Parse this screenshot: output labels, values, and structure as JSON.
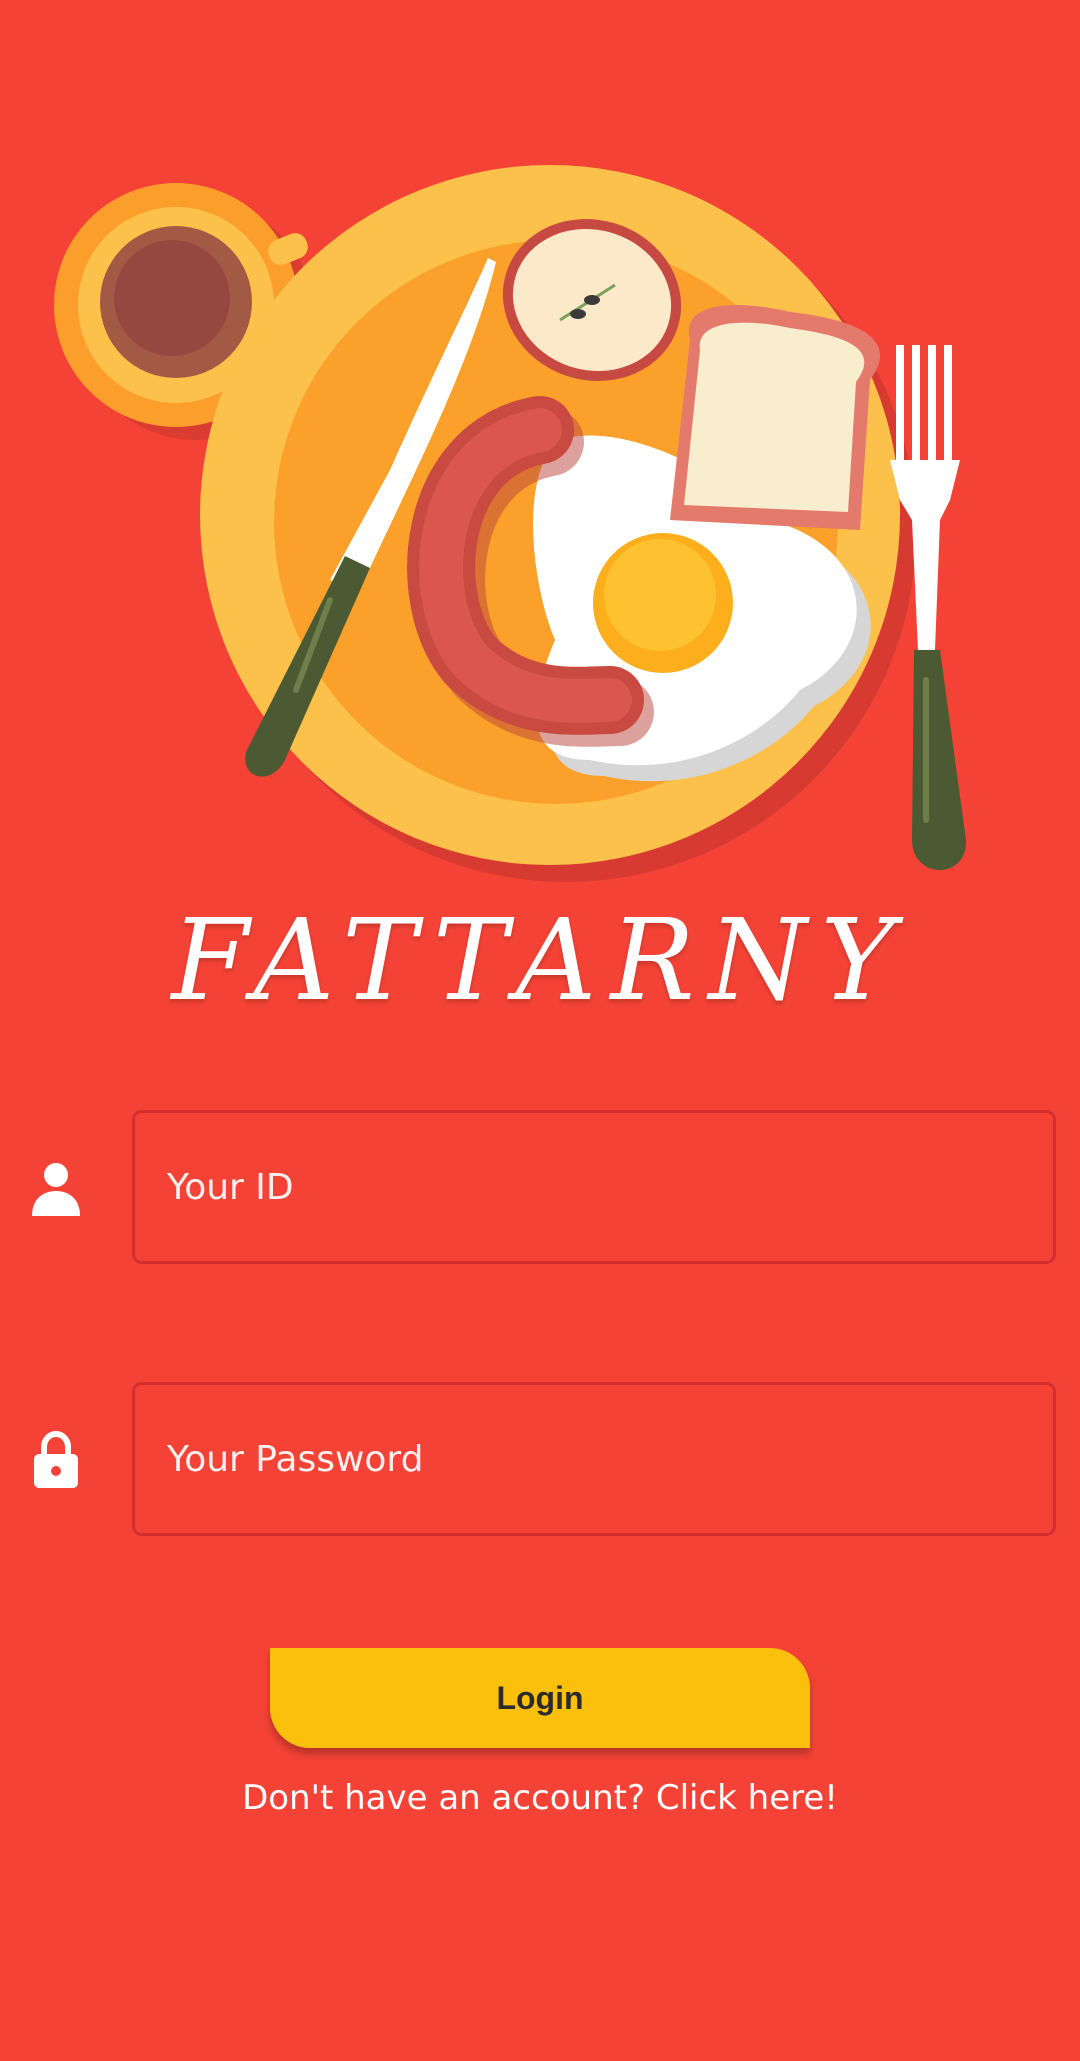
{
  "app": {
    "name": "FATTARNY"
  },
  "colors": {
    "background": "#f44336",
    "plate": "#fcc14a",
    "button": "#fbc00b",
    "field_border": "#d32f2f",
    "text": "#ffffff"
  },
  "hero": {
    "icon": "breakfast-plate-illustration"
  },
  "form": {
    "id_field": {
      "placeholder": "Your ID",
      "value": "",
      "icon": "person-icon"
    },
    "password_field": {
      "placeholder": "Your Password",
      "value": "",
      "icon": "lock-icon"
    },
    "login_label": "Login",
    "signup_text": "Don't have an account? Click here!"
  }
}
